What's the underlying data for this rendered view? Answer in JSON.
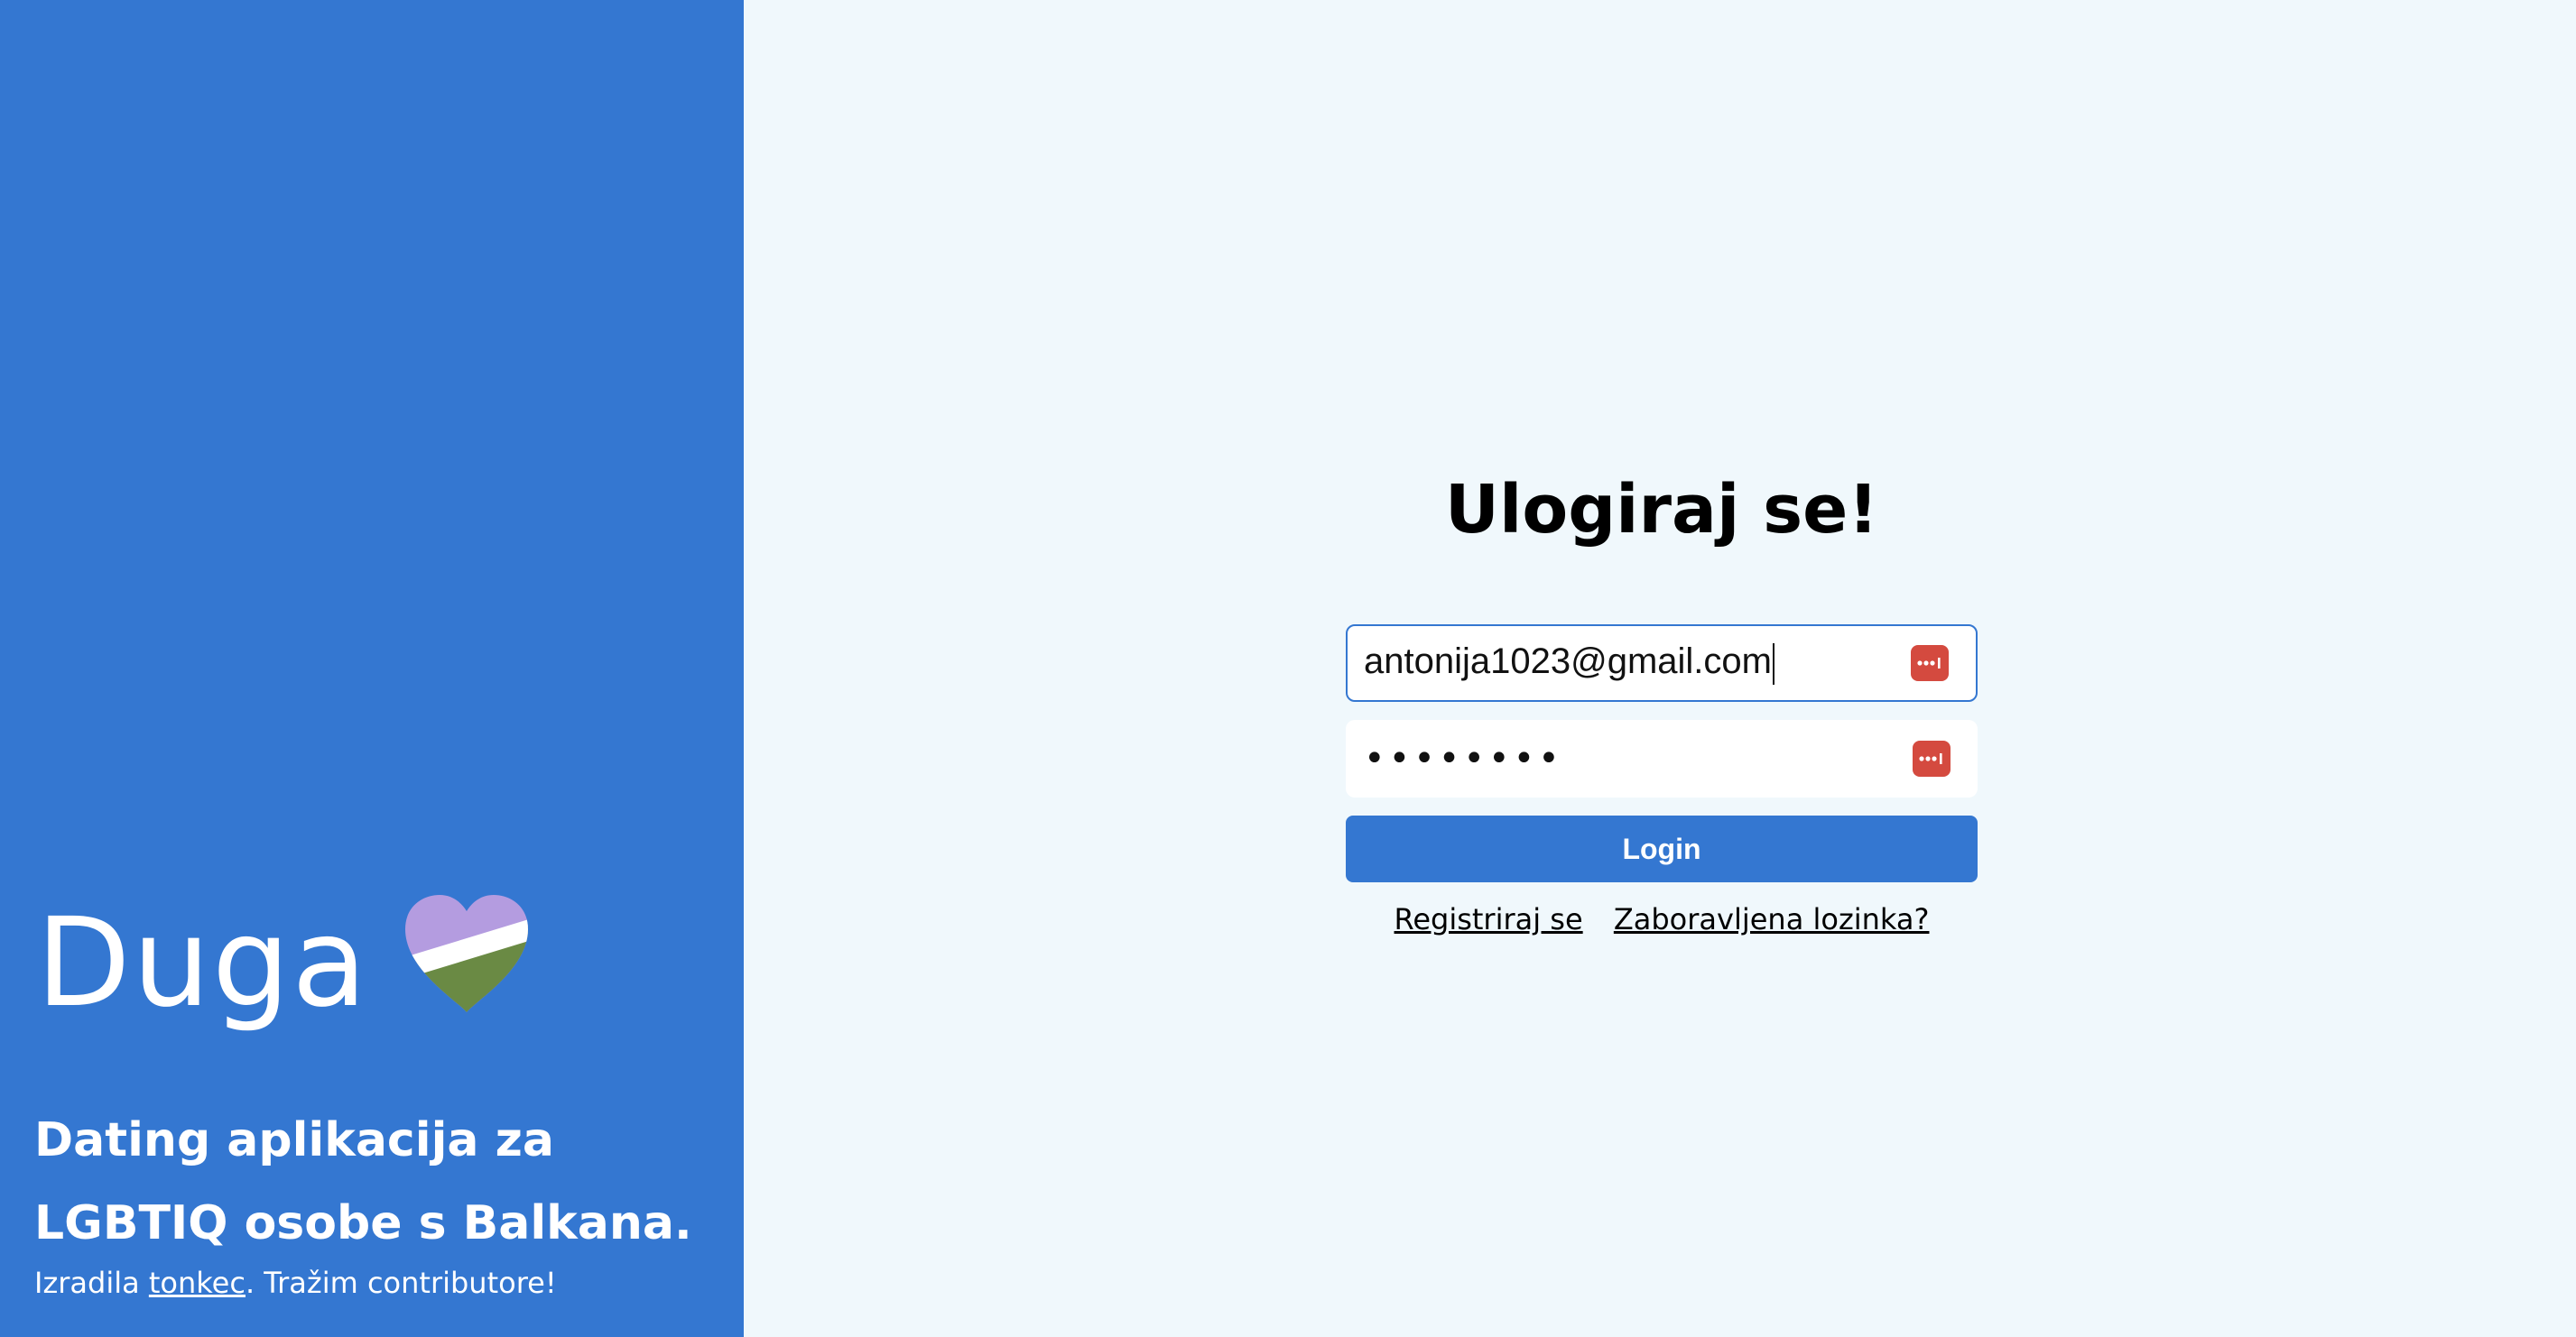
{
  "sidebar": {
    "brand_name": "Duga",
    "tagline": "Dating aplikacija za LGBTIQ osobe s Balkana.",
    "credit_prefix": "Izradila ",
    "credit_link": "tonkec",
    "credit_suffix": ". Tražim contributore!"
  },
  "login": {
    "title": "Ulogiraj se!",
    "email_value": "antonija1023@gmail.com",
    "password_mask": "••••••••",
    "button_label": "Login",
    "register_link": "Registriraj se",
    "forgot_link": "Zaboravljena lozinka?"
  },
  "colors": {
    "primary": "#3477d1",
    "background": "#f0f8fc",
    "password_manager_icon": "#d44a3f",
    "heart_top": "#b49ce0",
    "heart_bottom": "#6a8a44"
  },
  "icons": {
    "brand": "heart-icon",
    "field_addon": "password-manager-icon"
  }
}
